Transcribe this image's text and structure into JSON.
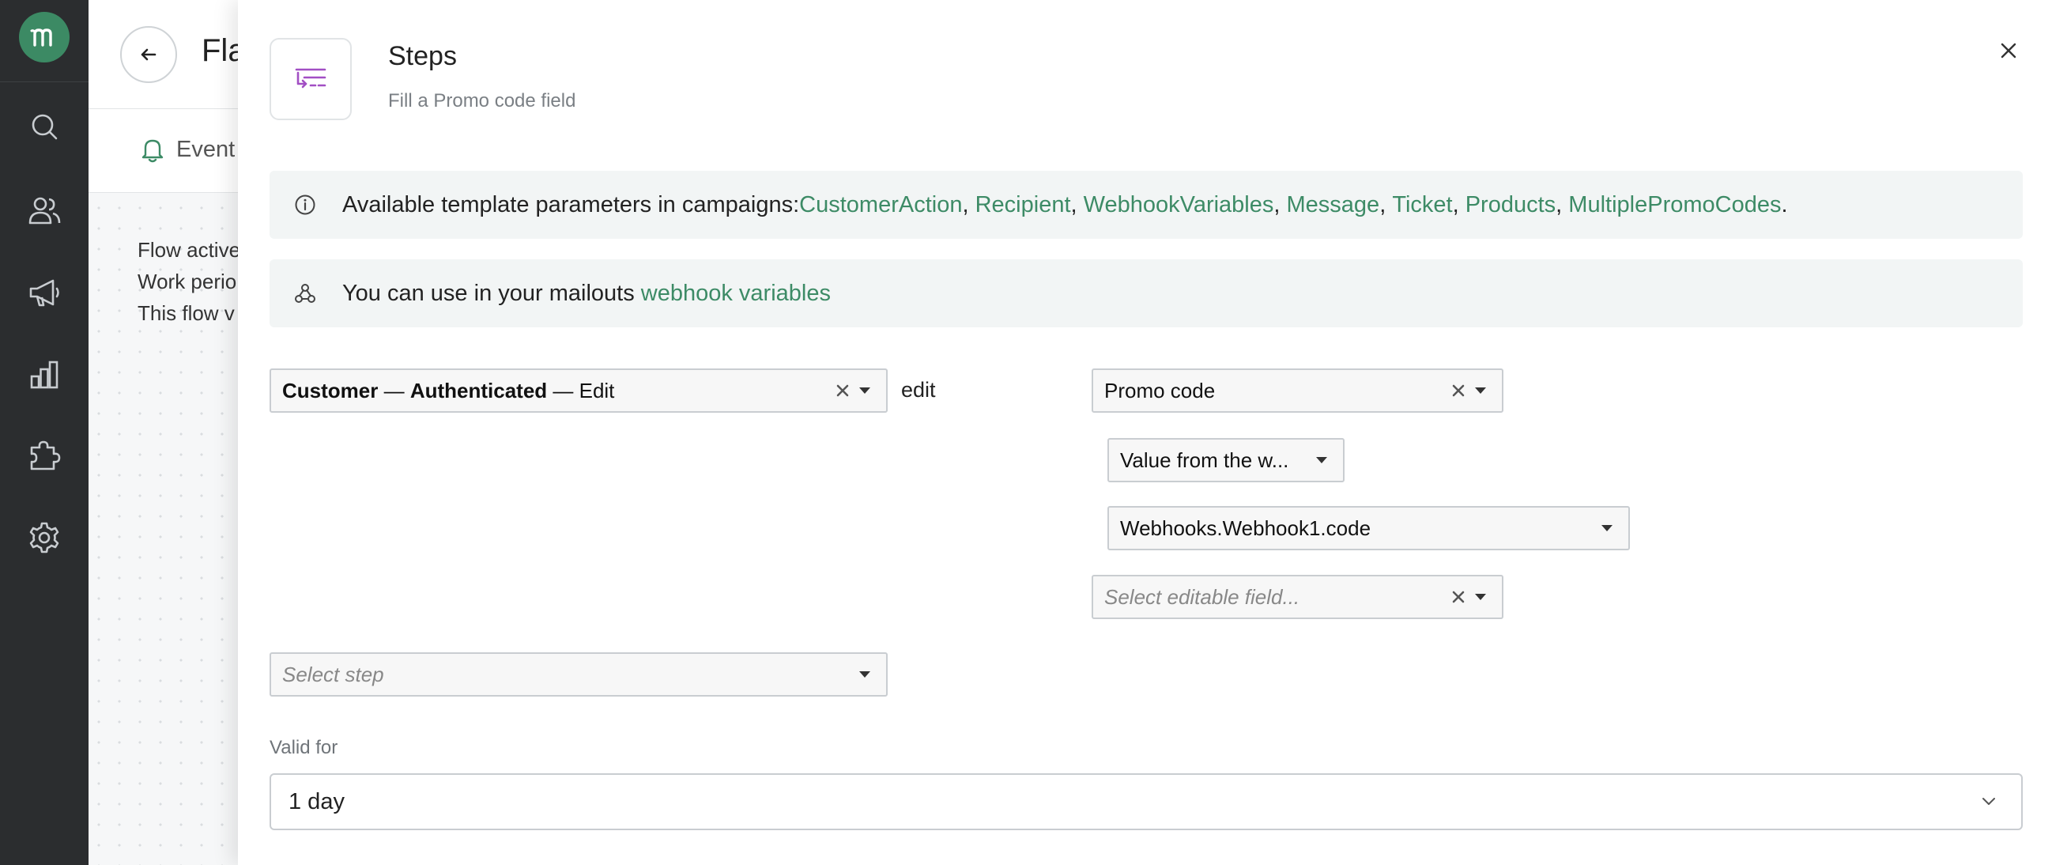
{
  "rail": {
    "logo_icon": "brand-logo-icon",
    "items": [
      {
        "icon": "search-icon"
      },
      {
        "icon": "users-icon"
      },
      {
        "icon": "megaphone-icon"
      },
      {
        "icon": "analytics-icon"
      },
      {
        "icon": "puzzle-icon"
      },
      {
        "icon": "gear-icon"
      }
    ]
  },
  "page": {
    "title": "Fla",
    "tab_events": "Event",
    "info_lines": [
      "Flow active",
      "Work perio",
      "This flow v"
    ]
  },
  "drawer": {
    "title": "Steps",
    "subtitle": "Fill a Promo code field",
    "notice_params": {
      "prefix": "Available template parameters in campaigns: ",
      "links": [
        "CustomerAction",
        "Recipient",
        "WebhookVariables",
        "Message",
        "Ticket",
        "Products",
        "MultiplePromoCodes"
      ],
      "suffix": "."
    },
    "notice_webhook": {
      "prefix": "You can use in your mailouts ",
      "link": "webhook variables"
    },
    "entity_select": {
      "part1": "Customer",
      "sep1": " — ",
      "part2": "Authenticated",
      "sep2": " — Edit"
    },
    "edit_label": "edit",
    "field_select": "Promo code",
    "source_select": "Value from the w...",
    "webhook_select": "Webhooks.Webhook1.code",
    "editable_field_placeholder": "Select editable field...",
    "step_placeholder": "Select step",
    "valid_for_label": "Valid for",
    "valid_for_value": "1 day"
  },
  "colors": {
    "accent": "#3d8b66",
    "rail_bg": "#2b2d2f",
    "logo_bg": "#3c8a64",
    "step_icon": "#a24fc4"
  }
}
